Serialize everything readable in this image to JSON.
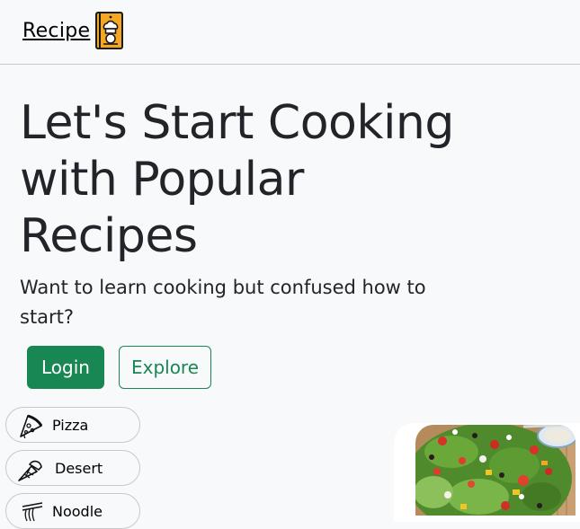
{
  "navbar": {
    "brand": "Recipe",
    "brand_icon": "chef-book-icon"
  },
  "hero": {
    "title": "Let's Start Cooking with Popular Recipes",
    "subtitle": "Want to learn cooking but confused how to start?",
    "login_label": "Login",
    "explore_label": "Explore"
  },
  "categories": [
    {
      "label": "Pizza",
      "icon": "pizza-icon"
    },
    {
      "label": "Desert",
      "icon": "ice-cream-icon"
    },
    {
      "label": "Noodle",
      "icon": "noodle-icon"
    }
  ],
  "colors": {
    "primary": "#198754",
    "background": "#f8f9fa",
    "text": "#212529",
    "logo_orange": "#f5a623"
  },
  "image": {
    "subject": "salad-photo"
  }
}
